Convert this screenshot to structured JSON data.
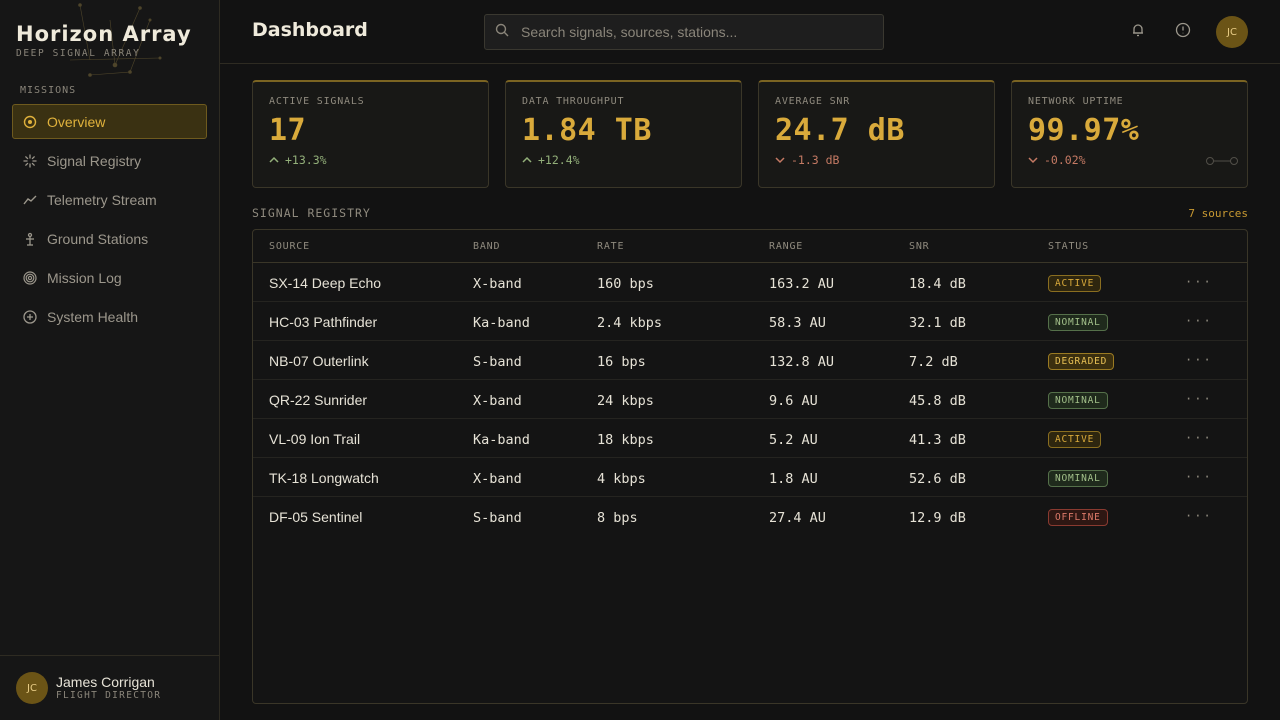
{
  "brand": {
    "title": "Horizon Array",
    "subtitle": "DEEP SIGNAL ARRAY"
  },
  "sidebar": {
    "section_label": "MISSIONS",
    "items": [
      {
        "label": "Overview",
        "icon": "target-icon",
        "active": true
      },
      {
        "label": "Signal Registry",
        "icon": "sparkle-icon",
        "active": false
      },
      {
        "label": "Telemetry Stream",
        "icon": "trend-line-icon",
        "active": false
      },
      {
        "label": "Ground Stations",
        "icon": "antenna-tower-icon",
        "active": false
      },
      {
        "label": "Mission Log",
        "icon": "concentric-rings-icon",
        "active": false
      },
      {
        "label": "System Health",
        "icon": "plus-circle-icon",
        "active": false
      }
    ],
    "user": {
      "initials": "JC",
      "name": "James Corrigan",
      "role": "FLIGHT DIRECTOR"
    }
  },
  "header": {
    "title": "Dashboard",
    "search_placeholder": "Search signals, sources, stations...",
    "avatar_initials": "JC"
  },
  "stats": [
    {
      "label": "ACTIVE SIGNALS",
      "value": "17",
      "delta": "+13.3%",
      "direction": "up"
    },
    {
      "label": "DATA THROUGHPUT",
      "value": "1.84 TB",
      "delta": "+12.4%",
      "direction": "up"
    },
    {
      "label": "AVERAGE SNR",
      "value": "24.7 dB",
      "delta": "-1.3 dB",
      "direction": "down"
    },
    {
      "label": "NETWORK UPTIME",
      "value": "99.97%",
      "delta": "-0.02%",
      "direction": "down"
    }
  ],
  "registry": {
    "title": "SIGNAL REGISTRY",
    "count": "7 sources",
    "columns": [
      "SOURCE",
      "BAND",
      "RATE",
      "RANGE",
      "SNR",
      "STATUS"
    ],
    "rows": [
      {
        "source": "SX-14 Deep Echo",
        "band": "X-band",
        "rate": "160 bps",
        "range": "163.2 AU",
        "snr": "18.4 dB",
        "status": "ACTIVE"
      },
      {
        "source": "HC-03 Pathfinder",
        "band": "Ka-band",
        "rate": "2.4 kbps",
        "range": "58.3 AU",
        "snr": "32.1 dB",
        "status": "NOMINAL"
      },
      {
        "source": "NB-07 Outerlink",
        "band": "S-band",
        "rate": "16 bps",
        "range": "132.8 AU",
        "snr": "7.2 dB",
        "status": "DEGRADED"
      },
      {
        "source": "QR-22 Sunrider",
        "band": "X-band",
        "rate": "24 kbps",
        "range": "9.6 AU",
        "snr": "45.8 dB",
        "status": "NOMINAL"
      },
      {
        "source": "VL-09 Ion Trail",
        "band": "Ka-band",
        "rate": "18 kbps",
        "range": "5.2 AU",
        "snr": "41.3 dB",
        "status": "ACTIVE"
      },
      {
        "source": "TK-18 Longwatch",
        "band": "X-band",
        "rate": "4 kbps",
        "range": "1.8 AU",
        "snr": "52.6 dB",
        "status": "NOMINAL"
      },
      {
        "source": "DF-05 Sentinel",
        "band": "S-band",
        "rate": "8 bps",
        "range": "27.4 AU",
        "snr": "12.9 dB",
        "status": "OFFLINE"
      }
    ],
    "row_action": "···"
  },
  "colors": {
    "accent": "#d9aa3b",
    "positive": "#93b07a",
    "negative": "#c57a64",
    "background": "#121212"
  }
}
